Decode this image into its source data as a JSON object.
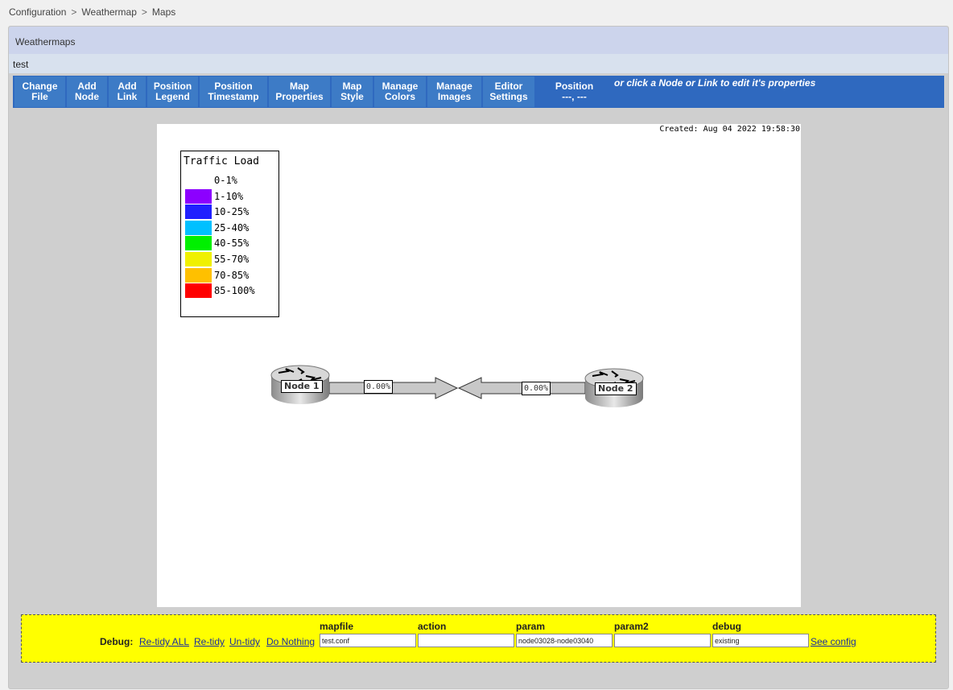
{
  "breadcrumb": [
    "Configuration",
    "Weathermap",
    "Maps"
  ],
  "panel": {
    "title": "Weathermaps",
    "map_name": "test"
  },
  "toolbar": {
    "buttons": [
      "Change\nFile",
      "Add\nNode",
      "Add\nLink",
      "Position\nLegend",
      "Position\nTimestamp",
      "Map\nProperties",
      "Map\nStyle",
      "Manage\nColors",
      "Manage\nImages",
      "Editor\nSettings"
    ],
    "position_label": "Position",
    "position_value": "---, ---",
    "hint": "or click a Node or Link to edit it's properties"
  },
  "map": {
    "created": "Created: Aug 04 2022 19:58:30",
    "legend_title": "Traffic Load",
    "legend": [
      {
        "label": "0-1%",
        "color": "#ffffff"
      },
      {
        "label": "1-10%",
        "color": "#8c00ff"
      },
      {
        "label": "10-25%",
        "color": "#2020ff"
      },
      {
        "label": "25-40%",
        "color": "#00c0ff"
      },
      {
        "label": "40-55%",
        "color": "#00f000"
      },
      {
        "label": "55-70%",
        "color": "#f0f000"
      },
      {
        "label": "70-85%",
        "color": "#ffc000"
      },
      {
        "label": "85-100%",
        "color": "#ff0000"
      }
    ],
    "node1": "Node 1",
    "node2": "Node 2",
    "link_out": "0.00%",
    "link_in": "0.00%"
  },
  "debug": {
    "label": "Debug:",
    "links": [
      "Re-tidy ALL",
      "Re-tidy",
      "Un-tidy",
      "Do Nothing"
    ],
    "headers": [
      "mapfile",
      "action",
      "param",
      "param2",
      "debug"
    ],
    "values": [
      "test.conf",
      "",
      "node03028-node03040",
      "",
      "existing"
    ],
    "see_config": "See config"
  }
}
